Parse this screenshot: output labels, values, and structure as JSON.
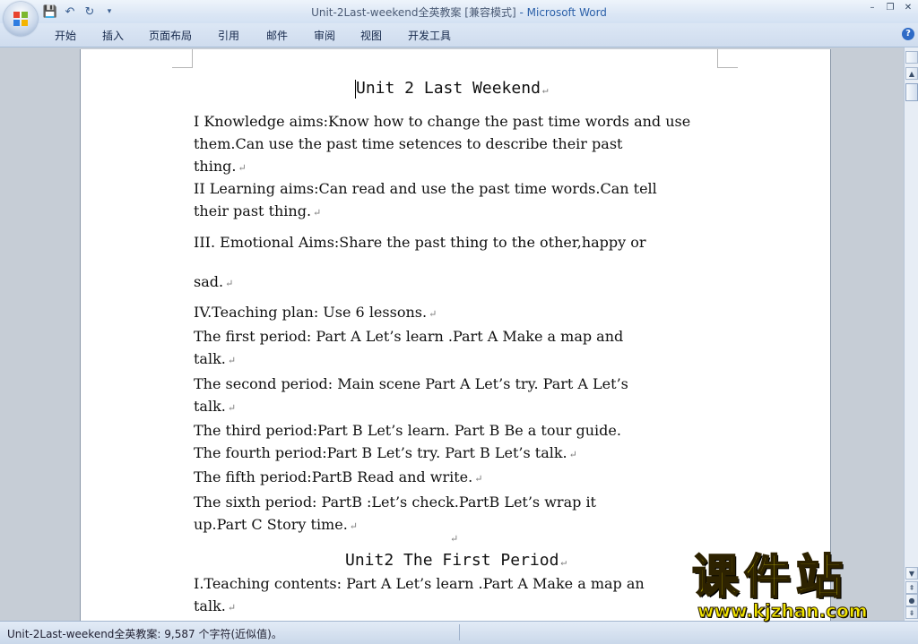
{
  "window": {
    "doc_name": "Unit-2Last-weekend全英教案 [兼容模式]",
    "separator": " - ",
    "app_name": "Microsoft Word",
    "min": "–",
    "restore": "❐",
    "close": "✕"
  },
  "qat": {
    "save": "💾",
    "undo": "↶",
    "redo": "↻",
    "more": "▾"
  },
  "tabs": [
    "开始",
    "插入",
    "页面布局",
    "引用",
    "邮件",
    "审阅",
    "视图",
    "开发工具"
  ],
  "help": "?",
  "document": {
    "title": "Unit 2  Last Weekend",
    "para1": [
      "I Knowledge aims:Know how to change the past time words and use",
      "them.Can use the past time setences to describe their past",
      "thing."
    ],
    "para2": [
      "II Learning aims:Can read and use the past time words.Can tell",
      "their past thing."
    ],
    "para3": "III. Emotional Aims:Share the past thing to the other,happy or",
    "para4": "sad.",
    "para5": [
      "IV.Teaching plan: Use 6 lessons.",
      "The first period: Part A Let’s learn .Part A Make a map and",
      "talk.",
      "The second period: Main scene Part A Let’s try. Part A Let’s",
      "talk.",
      "The third period:Part B Let’s learn. Part B Be a tour guide.",
      "The fourth period:Part B Let’s try. Part B Let’s talk.",
      "The fifth period:PartB Read and write.",
      "The sixth period: PartB :Let’s check.PartB Let’s wrap it",
      "up.Part C Story time."
    ],
    "para5_marks": [
      true,
      false,
      true,
      false,
      true,
      false,
      true,
      true,
      false,
      true
    ],
    "title2": "Unit2 The First Period",
    "para7": [
      "I.Teaching contents: Part A Let’s learn .Part A Make a map an",
      "talk."
    ],
    "mark": "↵"
  },
  "status": {
    "text": "Unit-2Last-weekend全英教案: 9,587 个字符(近似值)。"
  },
  "watermark": {
    "cn": "课件站",
    "url": "www.kjzhan.com"
  },
  "colors": {
    "accent": "#2a5fa8",
    "ribbon": "#dce7f5",
    "watermark": "#f3e600"
  }
}
